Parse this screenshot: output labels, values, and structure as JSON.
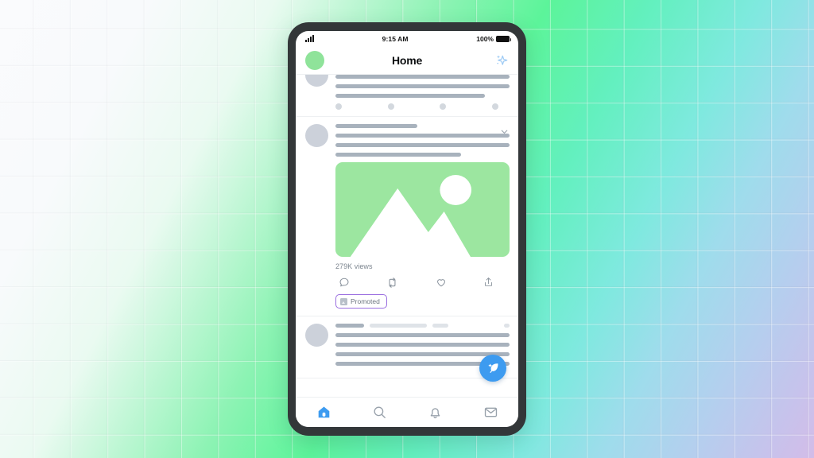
{
  "background": {
    "style": "grid-gradient",
    "colors": [
      "#fafbfd",
      "#5cf49a",
      "#7fe9df",
      "#b4cfee",
      "#d3bce8"
    ]
  },
  "device": {
    "frame_color": "#333739",
    "screen_color": "#ffffff"
  },
  "status_bar": {
    "signal_icon": "cellular-signal-icon",
    "time": "9:15 AM",
    "battery_percent": "100%",
    "battery_icon": "battery-full-icon"
  },
  "app_header": {
    "avatar_icon": "profile-avatar",
    "avatar_color": "#8fe39a",
    "title": "Home",
    "action_icon": "sparkle-icon",
    "action_color": "#9ecbf5"
  },
  "feed": {
    "posts": [
      {
        "id": "post-partial-top",
        "avatar_color": "#ccd1da",
        "lines": [
          100,
          100,
          86
        ],
        "dots": 4
      },
      {
        "id": "post-promoted",
        "avatar_color": "#ccd1da",
        "name_bar_width": 47,
        "lines": [
          100,
          100,
          72
        ],
        "chevron_icon": "chevron-down-icon",
        "media": {
          "icon": "image-placeholder-icon",
          "color": "#9ce6a0",
          "shapes": [
            "sun-circle",
            "mountain-range"
          ]
        },
        "views_text": "279K views",
        "actions": [
          {
            "icon": "reply-icon",
            "label": "Reply"
          },
          {
            "icon": "retweet-icon",
            "label": "Repost"
          },
          {
            "icon": "heart-icon",
            "label": "Like"
          },
          {
            "icon": "share-icon",
            "label": "Share"
          }
        ],
        "badge": {
          "icon": "promoted-icon",
          "label": "Promoted",
          "border_color": "#9b6fe0"
        }
      },
      {
        "id": "post-bottom",
        "avatar_color": "#ccd1da",
        "meta_bars": [
          36,
          72,
          20,
          7
        ],
        "lines": [
          100,
          100,
          100,
          100
        ]
      }
    ]
  },
  "compose": {
    "icon": "compose-feather-sparkle-icon",
    "color": "#3d9bf0"
  },
  "tab_bar": {
    "tabs": [
      {
        "icon": "home-icon",
        "label": "Home",
        "active": true
      },
      {
        "icon": "search-icon",
        "label": "Search",
        "active": false
      },
      {
        "icon": "bell-icon",
        "label": "Notifications",
        "active": false
      },
      {
        "icon": "mail-icon",
        "label": "Messages",
        "active": false
      }
    ],
    "active_color": "#3d9bf0",
    "inactive_color": "#98a1ab"
  }
}
